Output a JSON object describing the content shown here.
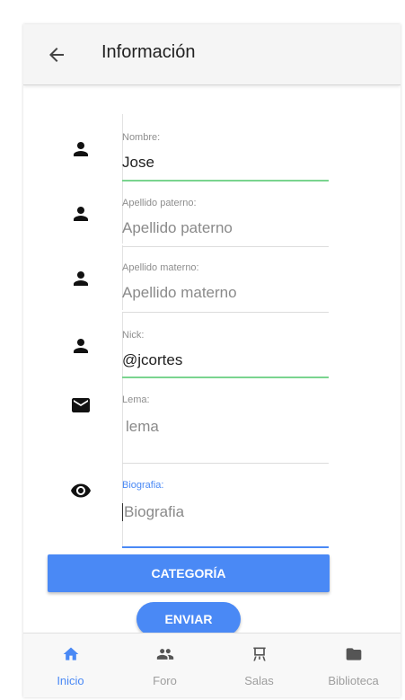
{
  "header": {
    "title": "Información",
    "back_icon": "arrow-left-icon"
  },
  "form": {
    "fields": [
      {
        "icon": "person-icon",
        "label": "Nombre:",
        "value": "Jose",
        "placeholder": "Nombre"
      },
      {
        "icon": "person-icon",
        "label": "Apellido paterno:",
        "value": "",
        "placeholder": "Apellido paterno"
      },
      {
        "icon": "person-icon",
        "label": "Apellido materno:",
        "value": "",
        "placeholder": "Apellido materno"
      },
      {
        "icon": "person-icon",
        "label": "Nick:",
        "value": "@jcortes",
        "placeholder": "Nick"
      },
      {
        "icon": "mail-icon",
        "label": "Lema:",
        "value": "",
        "placeholder": "lema"
      },
      {
        "icon": "eye-icon",
        "label": "Biografia:",
        "value": "",
        "placeholder": "Biografia"
      }
    ]
  },
  "buttons": {
    "categoria": "CATEGORÍA",
    "enviar": "ENVIAR"
  },
  "bottom_nav": {
    "items": [
      {
        "label": "Inicio",
        "icon": "home-icon",
        "active": true
      },
      {
        "label": "Foro",
        "icon": "group-icon",
        "active": false
      },
      {
        "label": "Salas",
        "icon": "easel-icon",
        "active": false
      },
      {
        "label": "Biblioteca",
        "icon": "folder-icon",
        "active": false
      }
    ]
  },
  "colors": {
    "accent": "#4a89f5",
    "valid": "#7ad48f",
    "header_bg": "#f5f5f5"
  }
}
